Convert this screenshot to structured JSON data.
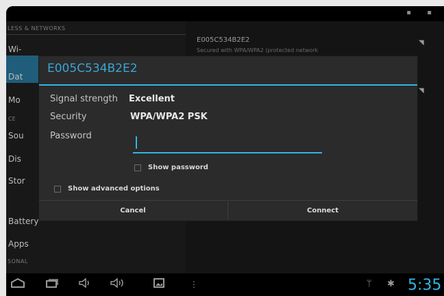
{
  "settings": {
    "section_wireless": "LESS & NETWORKS",
    "left_items": [
      "Wi-",
      "Dat",
      "Mo",
      "CE",
      "Sou",
      "Dis",
      "Stor",
      "Battery",
      "Apps"
    ],
    "section_personal": "SONAL",
    "network": {
      "name": "E005C534B2E2",
      "subtitle": "Secured with WPA/WPA2 (protected network"
    }
  },
  "dialog": {
    "title": "E005C534B2E2",
    "signal_label": "Signal strength",
    "signal_value": "Excellent",
    "security_label": "Security",
    "security_value": "WPA/WPA2 PSK",
    "password_label": "Password",
    "password_value": "",
    "show_password_label": "Show password",
    "show_advanced_label": "Show advanced options",
    "cancel_label": "Cancel",
    "connect_label": "Connect"
  },
  "status": {
    "clock": "5:35"
  },
  "icons": {
    "home": "home-icon",
    "recents": "recent-apps-icon",
    "volume_down": "volume-down-icon",
    "volume_up": "volume-up-icon",
    "screenshot": "screenshot-icon",
    "menu": "menu-icon",
    "usb": "usb-icon",
    "android": "android-debug-icon",
    "wifi": "wifi-signal-icon"
  },
  "colors": {
    "accent": "#33b5e5",
    "title": "#3aa5d6",
    "dialog_bg": "#2b2b2b",
    "selected_bg": "#1f5d7a"
  }
}
